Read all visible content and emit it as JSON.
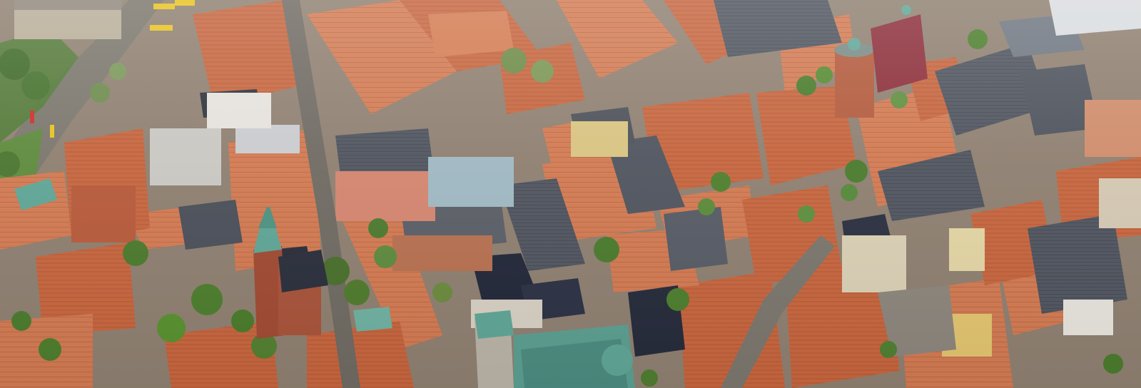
{
  "scene": {
    "description_kind": "oblique aerial photograph",
    "palette": {
      "roof_tile": "#c7663f",
      "roof_tile_light": "#d9825a",
      "roof_slate": "#4c5058",
      "roof_dark": "#2b2f3a",
      "facade_cream": "#d9c9a8",
      "facade_grey": "#a9a9a4",
      "copper_green": "#5fa596",
      "tree_green": "#4f7a34",
      "street": "#7e7a72",
      "square": "#8f877c"
    }
  }
}
